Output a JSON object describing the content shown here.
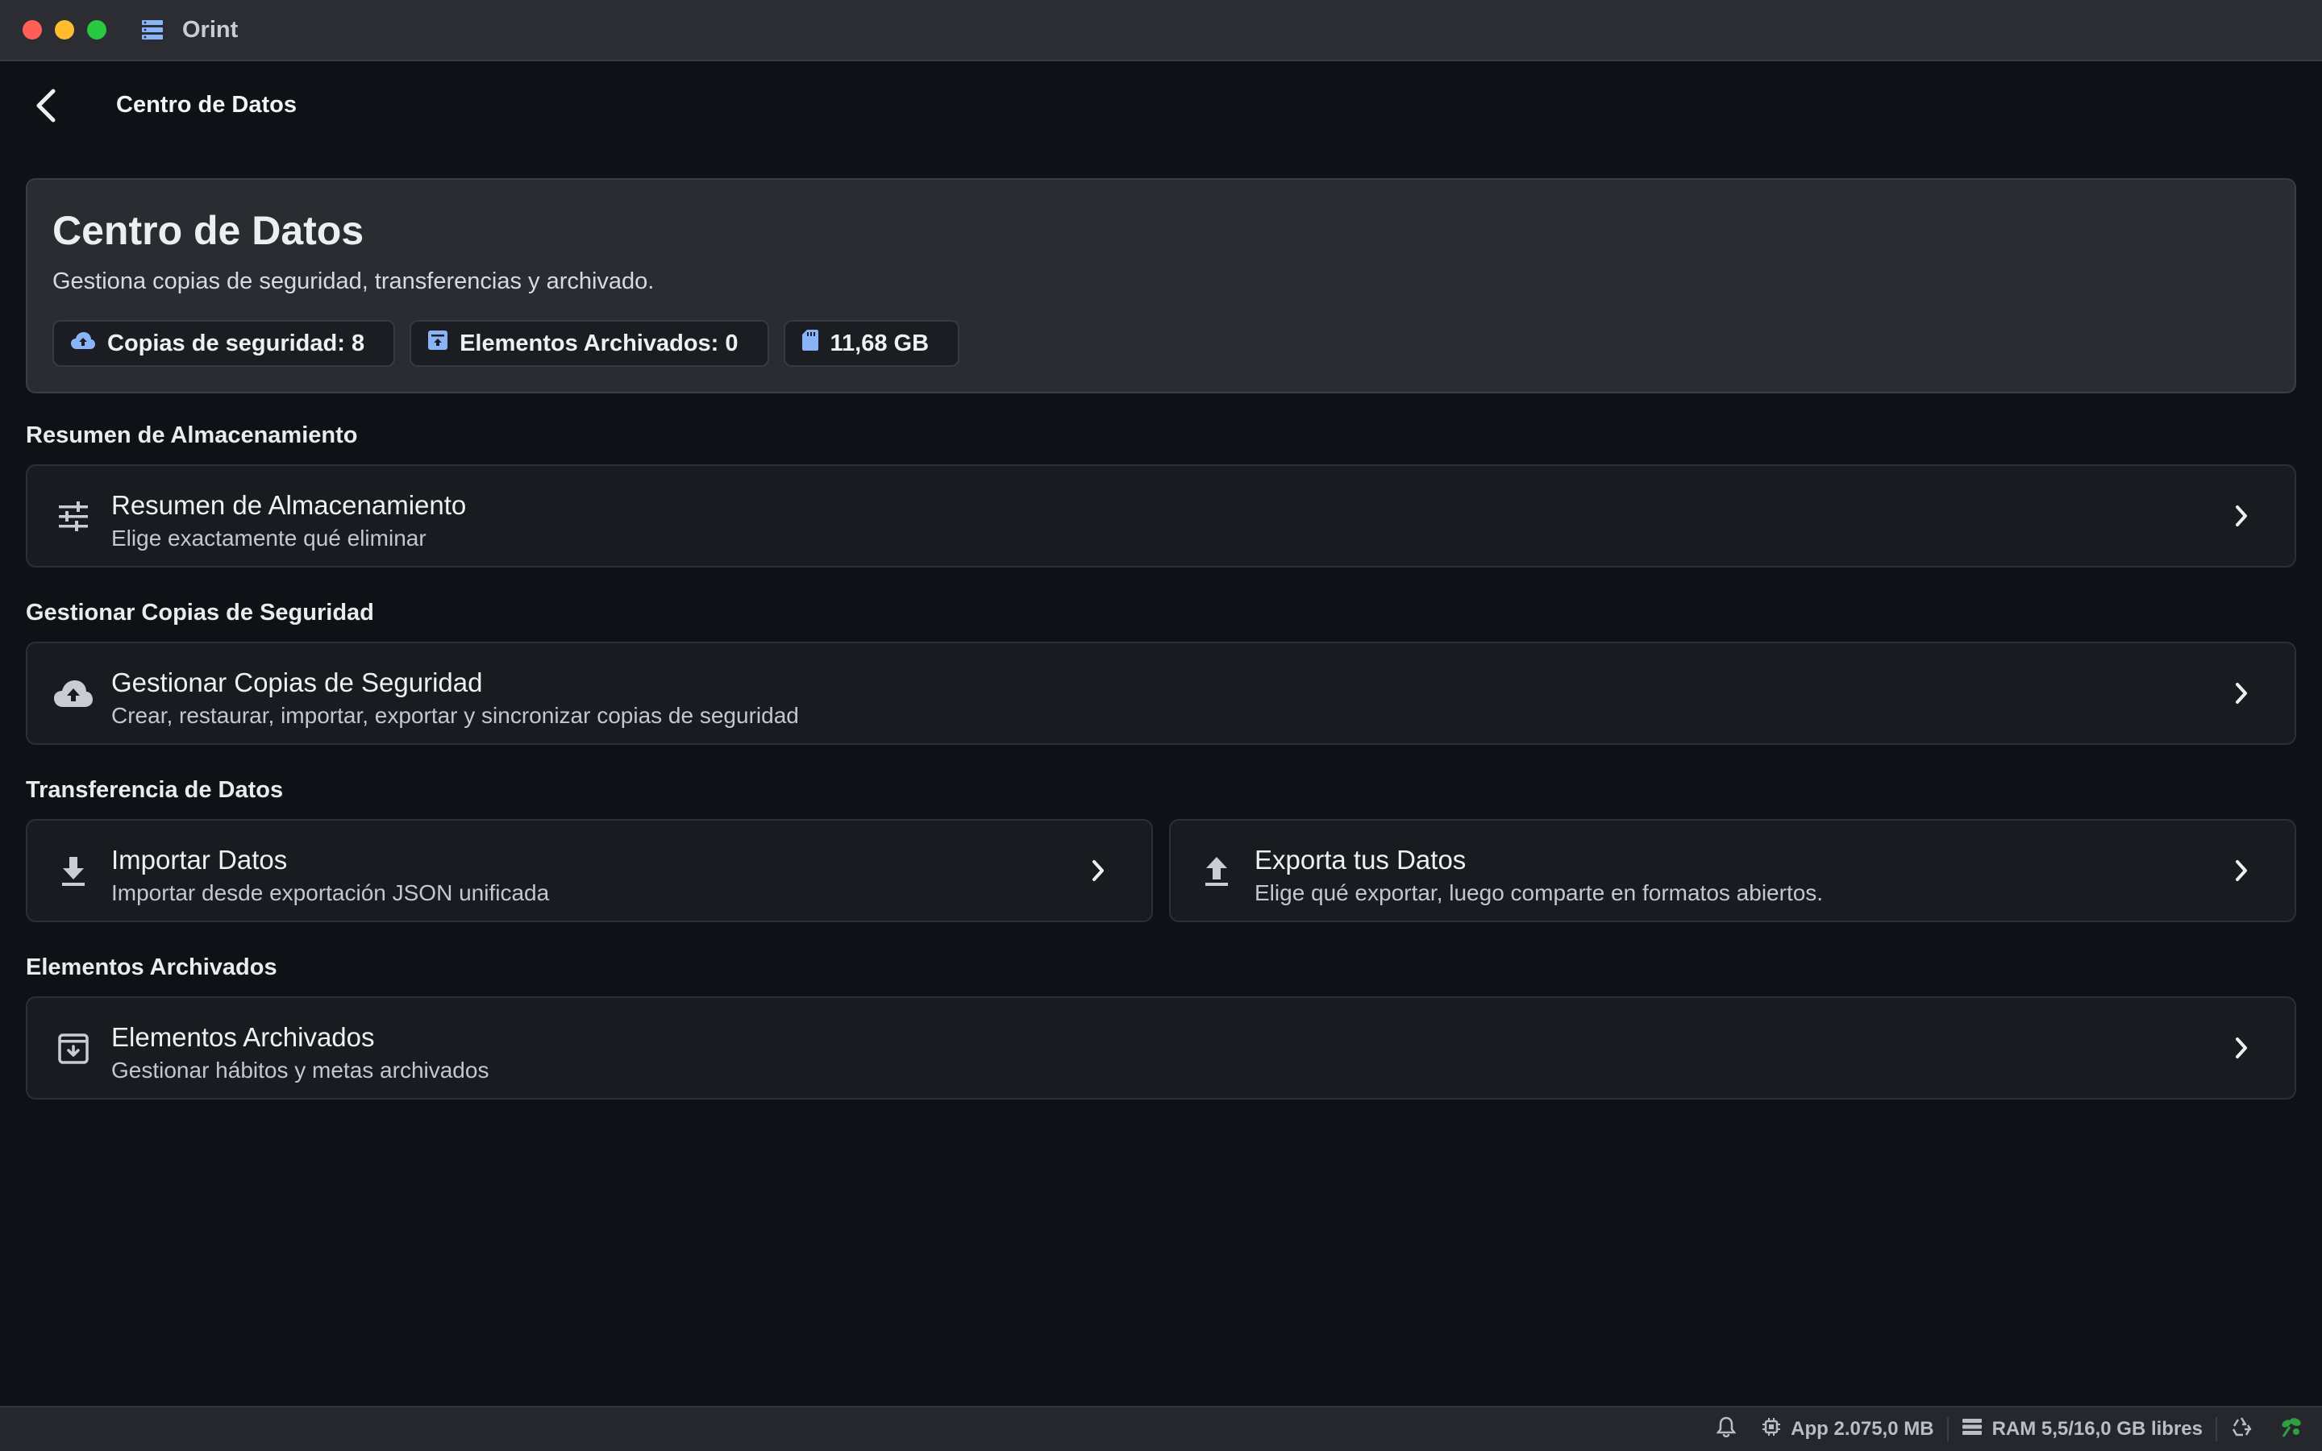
{
  "window": {
    "app_name": "Orint"
  },
  "header": {
    "title": "Centro de Datos"
  },
  "hero": {
    "title": "Centro de Datos",
    "subtitle": "Gestiona copias de seguridad, transferencias y archivado.",
    "chips": [
      {
        "label": "Copias de seguridad: 8",
        "icon": "cloud-upload-icon"
      },
      {
        "label": "Elementos Archivados: 0",
        "icon": "archive-box-icon"
      },
      {
        "label": "11,68 GB",
        "icon": "sd-card-icon"
      }
    ]
  },
  "sections": {
    "storage": {
      "label": "Resumen de Almacenamiento",
      "card": {
        "title": "Resumen de Almacenamiento",
        "subtitle": "Elige exactamente qué eliminar",
        "icon": "sliders-icon"
      }
    },
    "backups": {
      "label": "Gestionar Copias de Seguridad",
      "card": {
        "title": "Gestionar Copias de Seguridad",
        "subtitle": "Crear, restaurar, importar, exportar y sincronizar copias de seguridad",
        "icon": "cloud-upload-icon"
      }
    },
    "transfer": {
      "label": "Transferencia de Datos",
      "import": {
        "title": "Importar Datos",
        "subtitle": "Importar desde exportación JSON unificada",
        "icon": "download-icon"
      },
      "export": {
        "title": "Exporta tus Datos",
        "subtitle": "Elige qué exportar, luego comparte en formatos abiertos.",
        "icon": "upload-icon"
      }
    },
    "archived": {
      "label": "Elementos Archivados",
      "card": {
        "title": "Elementos Archivados",
        "subtitle": "Gestionar hábitos y metas archivados",
        "icon": "archive-icon"
      }
    }
  },
  "statusbar": {
    "app_memory": "App 2.075,0 MB",
    "ram": "RAM 5,5/16,0 GB libres"
  },
  "colors": {
    "background": "#0f1116",
    "card": "#191b21",
    "hero": "#2a2c32",
    "accent_icon": "#8ab4f8",
    "status_green": "#2ea043"
  }
}
